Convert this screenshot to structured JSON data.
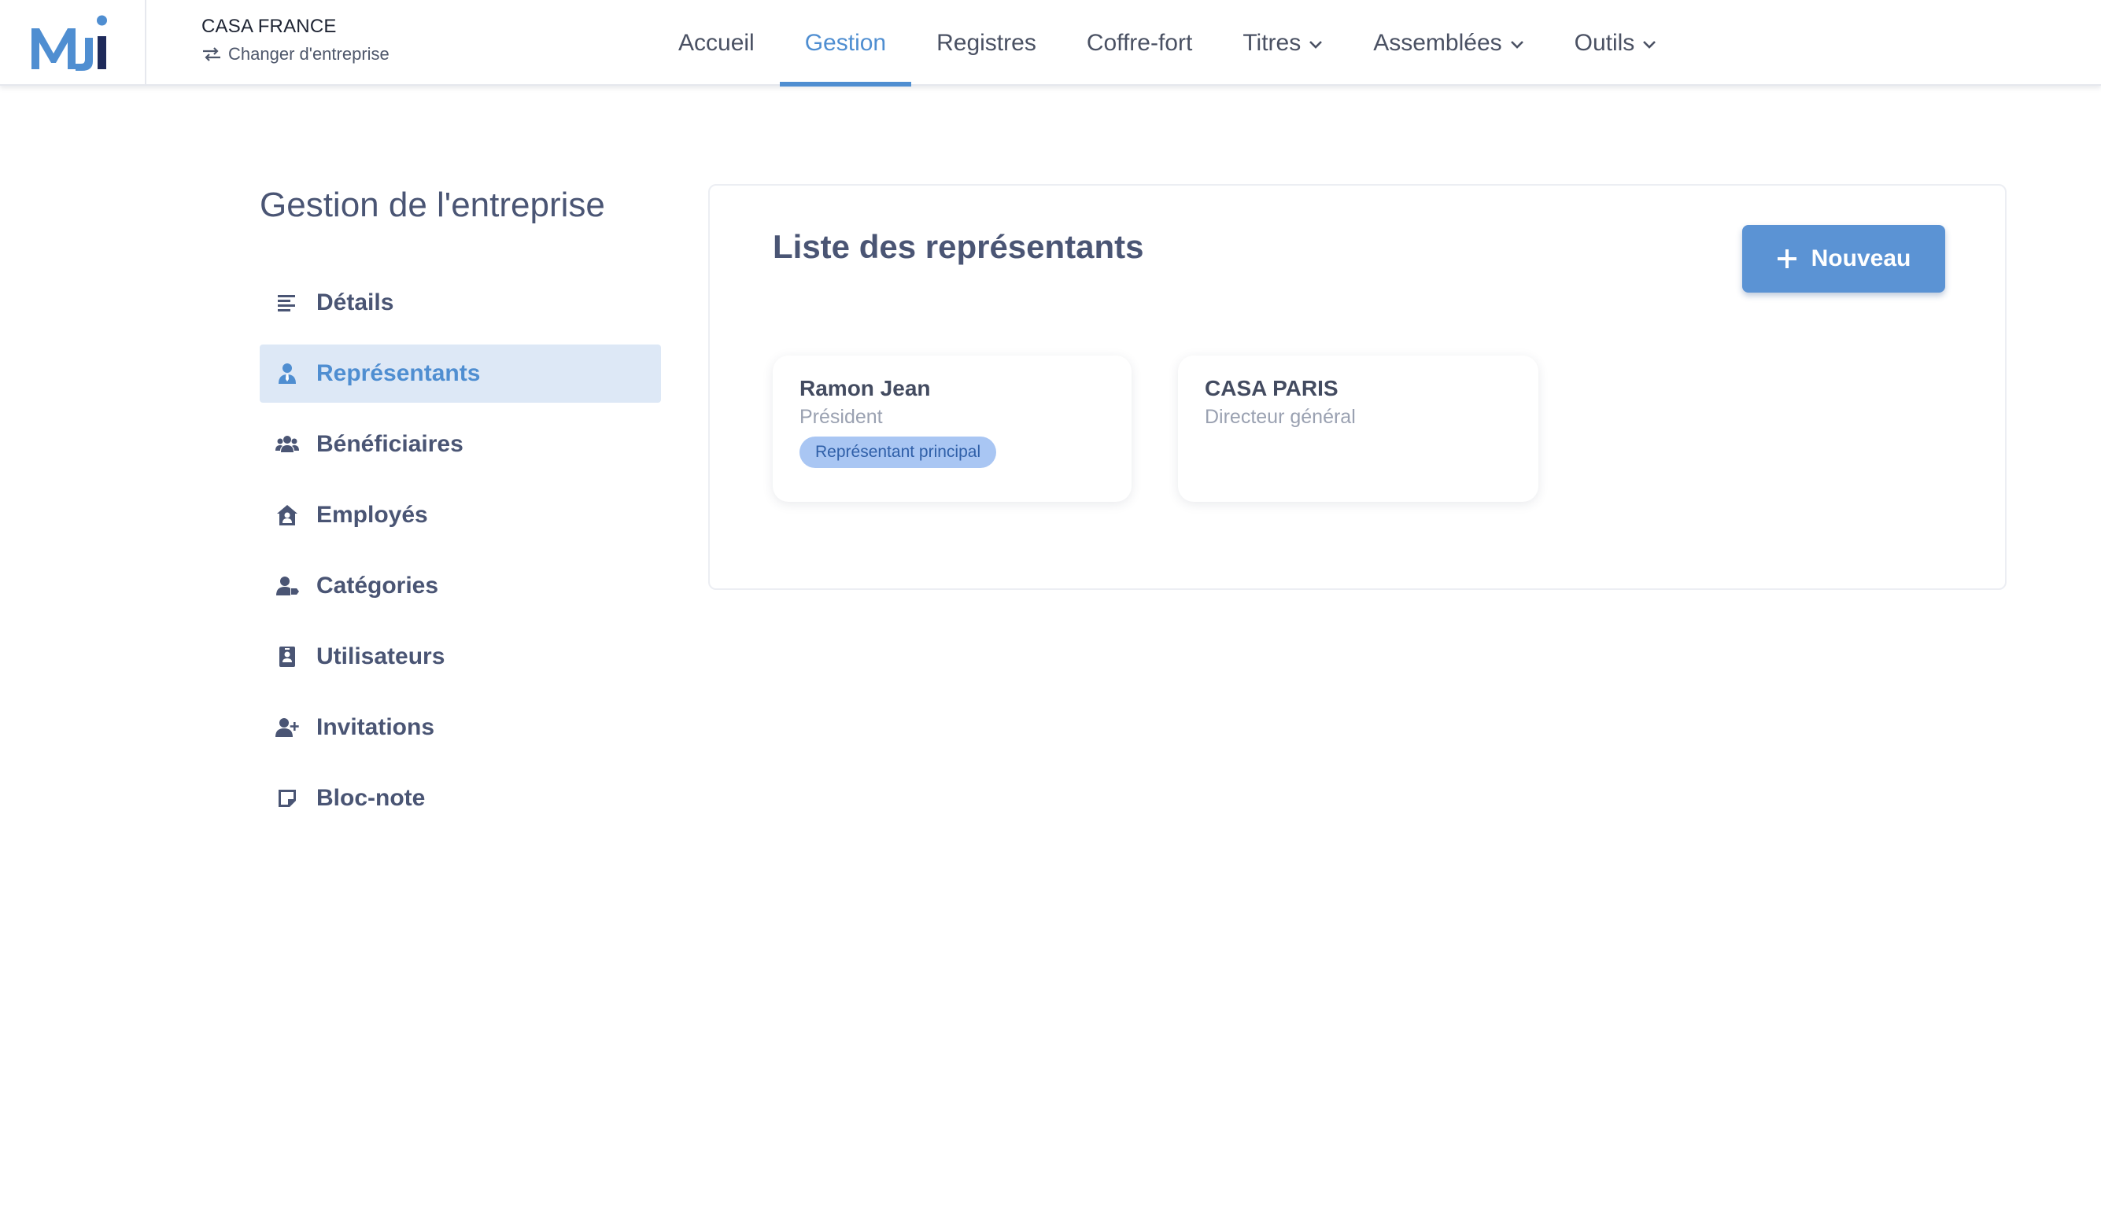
{
  "header": {
    "logo_text": "MJi",
    "company_name": "CASA FRANCE",
    "switch_label": "Changer d'entreprise",
    "nav": [
      {
        "label": "Accueil"
      },
      {
        "label": "Gestion"
      },
      {
        "label": "Registres"
      },
      {
        "label": "Coffre-fort"
      },
      {
        "label": "Titres"
      },
      {
        "label": "Assemblées"
      },
      {
        "label": "Outils"
      }
    ],
    "active_nav": "Gestion"
  },
  "sidebar": {
    "title": "Gestion de l'entreprise",
    "items": [
      {
        "label": "Détails",
        "icon": "align-left-icon"
      },
      {
        "label": "Représentants",
        "icon": "user-tie-icon"
      },
      {
        "label": "Bénéficiaires",
        "icon": "users-icon"
      },
      {
        "label": "Employés",
        "icon": "house-user-icon"
      },
      {
        "label": "Catégories",
        "icon": "user-tag-icon"
      },
      {
        "label": "Utilisateurs",
        "icon": "id-badge-icon"
      },
      {
        "label": "Invitations",
        "icon": "user-plus-icon"
      },
      {
        "label": "Bloc-note",
        "icon": "sticky-note-icon"
      }
    ],
    "active_item": "Représentants"
  },
  "main": {
    "title": "Liste des représentants",
    "new_button": "Nouveau",
    "representatives": [
      {
        "name": "Ramon Jean",
        "role": "Président",
        "badge": "Représentant principal"
      },
      {
        "name": "CASA PARIS",
        "role": "Directeur général"
      }
    ]
  },
  "colors": {
    "accent": "#4f8ed1",
    "button": "#5b93d4",
    "text": "#4a5574",
    "active_bg": "#dde8f6",
    "badge_bg": "#a9c6f3"
  }
}
